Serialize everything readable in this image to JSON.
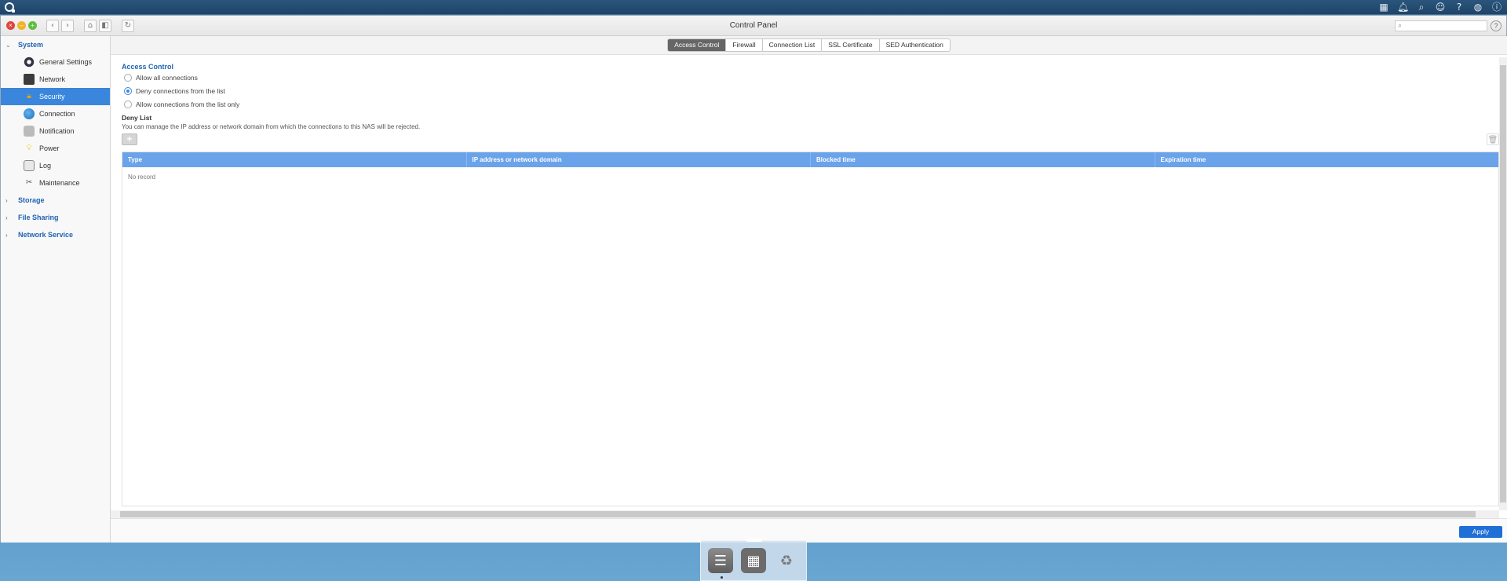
{
  "window": {
    "title": "Control Panel"
  },
  "search": {
    "placeholder": ""
  },
  "sidebar": {
    "groups": [
      {
        "label": "System",
        "expanded": true
      },
      {
        "label": "Storage",
        "expanded": false
      },
      {
        "label": "File Sharing",
        "expanded": false
      },
      {
        "label": "Network Service",
        "expanded": false
      }
    ],
    "items": [
      {
        "label": "General Settings",
        "icon": "gear-icon"
      },
      {
        "label": "Network",
        "icon": "network-icon"
      },
      {
        "label": "Security",
        "icon": "lock-icon",
        "active": true
      },
      {
        "label": "Connection",
        "icon": "globe-icon"
      },
      {
        "label": "Notification",
        "icon": "notification-icon"
      },
      {
        "label": "Power",
        "icon": "bulb-icon"
      },
      {
        "label": "Log",
        "icon": "log-icon"
      },
      {
        "label": "Maintenance",
        "icon": "tools-icon"
      }
    ]
  },
  "tabs": [
    "Access Control",
    "Firewall",
    "Connection List",
    "SSL Certificate",
    "SED Authentication"
  ],
  "active_tab": "Access Control",
  "access_control": {
    "title": "Access Control",
    "options": [
      {
        "label": "Allow all connections",
        "checked": false
      },
      {
        "label": "Deny connections from the list",
        "checked": true
      },
      {
        "label": "Allow connections from the list only",
        "checked": false
      }
    ]
  },
  "deny_list": {
    "title": "Deny List",
    "description": "You can manage the IP address or network domain from which the connections to this NAS will be rejected.",
    "columns": [
      "Type",
      "IP address or network domain",
      "Blocked time",
      "Expiration time"
    ],
    "empty_text": "No record"
  },
  "footer": {
    "apply_label": "Apply"
  },
  "colors": {
    "accent": "#3a86dc",
    "table_header": "#6aa3ea",
    "apply": "#1e6fd6"
  }
}
